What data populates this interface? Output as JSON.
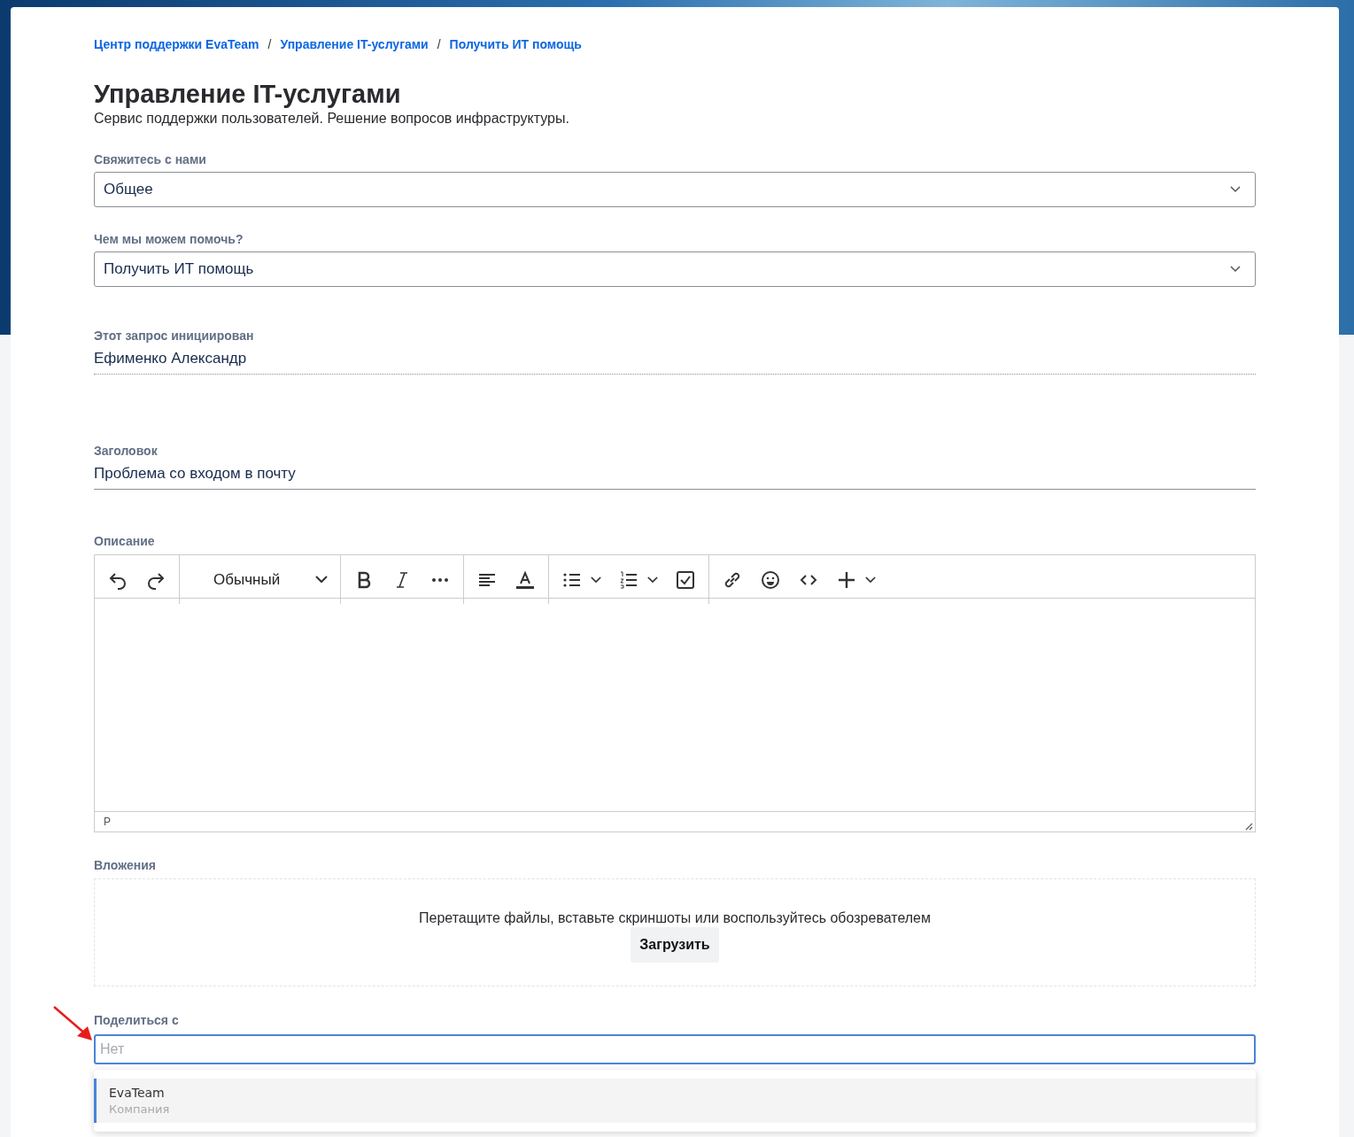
{
  "breadcrumbs": [
    "Центр поддержки EvaTeam",
    "Управление IT-услугами",
    "Получить ИТ помощь"
  ],
  "breadcrumb_separators": [
    "/",
    "/"
  ],
  "title": "Управление IT-услугами",
  "subtitle": "Сервис поддержки пользователей. Решение вопросов инфраструктуры.",
  "fields": [
    {
      "kind": "select",
      "label": "Свяжитесь с нами",
      "value": "Общее"
    },
    {
      "kind": "select",
      "label": "Чем мы можем помочь?",
      "value": "Получить ИТ помощь"
    },
    {
      "kind": "readonly",
      "label": "Этот запрос инициирован",
      "value": "Ефименко Александр"
    },
    {
      "kind": "text",
      "label": "Заголовок",
      "value": "Проблема со входом в почту"
    }
  ],
  "description": {
    "label": "Описание",
    "block_style": "Обычный",
    "path": "P"
  },
  "attachments": {
    "label": "Вложения",
    "hint": "Перетащите файлы, вставьте скриншоты или воспользуйтесь обозревателем",
    "button": "Загрузить"
  },
  "share": {
    "label": "Поделиться с",
    "placeholder": "Нет",
    "options": [
      {
        "name": "EvaTeam",
        "type": "Компания",
        "selected": true
      }
    ]
  }
}
